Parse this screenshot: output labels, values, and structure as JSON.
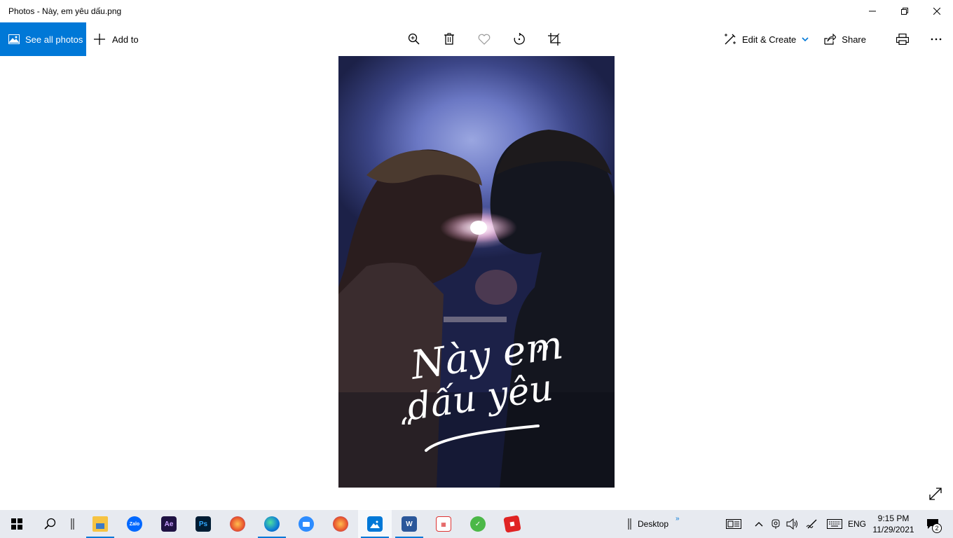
{
  "window": {
    "title": "Photos - Này, em yêu dấu.png"
  },
  "toolbar": {
    "see_all_label": "See all photos",
    "add_to_label": "Add to",
    "edit_create_label": "Edit & Create",
    "share_label": "Share"
  },
  "photo": {
    "overlay_line1": "Này em",
    "overlay_line2": "dấu yêu"
  },
  "taskbar": {
    "desktop_label": "Desktop",
    "language": "ENG",
    "time": "9:15 PM",
    "date": "11/29/2021",
    "notification_count": "2",
    "apps": [
      "file-explorer",
      "zalo",
      "after-effects",
      "photoshop",
      "firefox",
      "edge",
      "zoom",
      "firefox-2",
      "photos",
      "word",
      "tool-app",
      "green-app",
      "red-app"
    ]
  },
  "colors": {
    "accent": "#0078d7",
    "taskbar_bg": "#e7eaf0"
  }
}
